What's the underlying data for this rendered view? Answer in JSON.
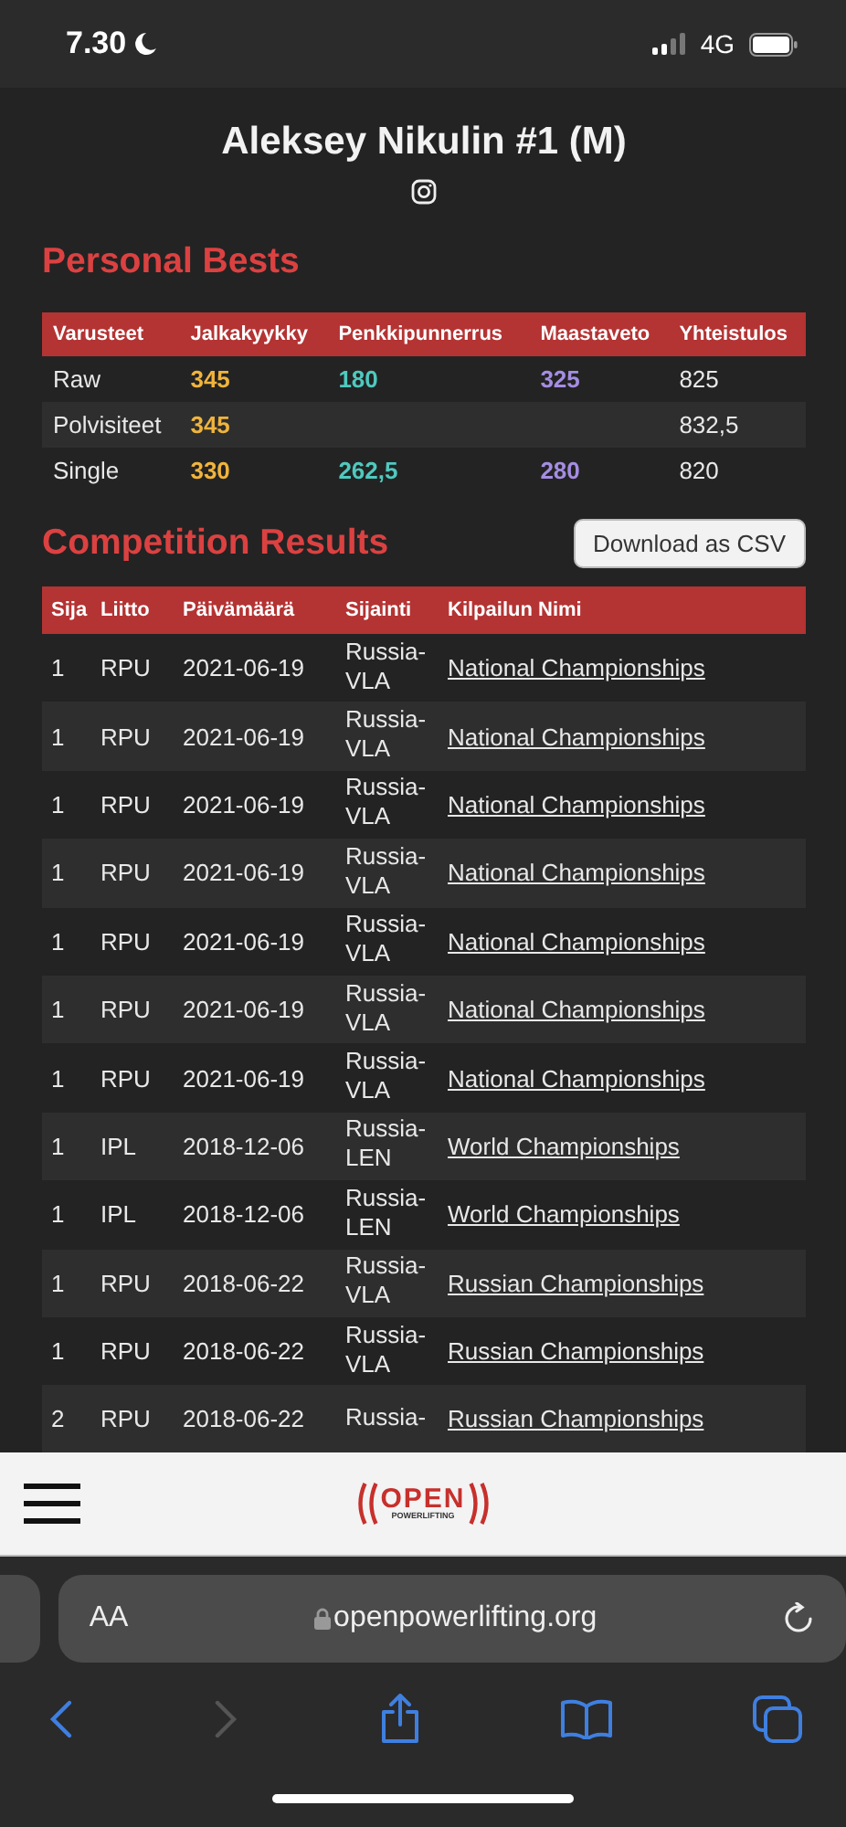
{
  "status_bar": {
    "time": "7.30",
    "network": "4G"
  },
  "athlete": {
    "name": "Aleksey Nikulin #1 (M)"
  },
  "personal_bests": {
    "title": "Personal Bests",
    "columns": [
      {
        "label": "Varusteet"
      },
      {
        "label": "Jalkakyykky",
        "color": "#f0b43c"
      },
      {
        "label": "Penkkipunnerrus",
        "color": "#4fc9bf"
      },
      {
        "label": "Maastaveto",
        "color": "#a58de2"
      },
      {
        "label": "Yhteistulos"
      }
    ],
    "rows": [
      [
        "Raw",
        "345",
        "180",
        "325",
        "825"
      ],
      [
        "Polvisiteet",
        "345",
        "",
        "",
        "832,5"
      ],
      [
        "Single",
        "330",
        "262,5",
        "280",
        "820"
      ]
    ]
  },
  "competition_results": {
    "title": "Competition Results",
    "download_button": "Download as CSV",
    "columns": [
      "Sija",
      "Liitto",
      "Päivämäärä",
      "Sijainti",
      "Kilpailun Nimi"
    ],
    "rows": [
      {
        "place": "1",
        "federation": "RPU",
        "date": "2021-06-19",
        "location": "Russia-VLA",
        "meet": "National Championships"
      },
      {
        "place": "1",
        "federation": "RPU",
        "date": "2021-06-19",
        "location": "Russia-VLA",
        "meet": "National Championships"
      },
      {
        "place": "1",
        "federation": "RPU",
        "date": "2021-06-19",
        "location": "Russia-VLA",
        "meet": "National Championships"
      },
      {
        "place": "1",
        "federation": "RPU",
        "date": "2021-06-19",
        "location": "Russia-VLA",
        "meet": "National Championships"
      },
      {
        "place": "1",
        "federation": "RPU",
        "date": "2021-06-19",
        "location": "Russia-VLA",
        "meet": "National Championships"
      },
      {
        "place": "1",
        "federation": "RPU",
        "date": "2021-06-19",
        "location": "Russia-VLA",
        "meet": "National Championships"
      },
      {
        "place": "1",
        "federation": "RPU",
        "date": "2021-06-19",
        "location": "Russia-VLA",
        "meet": "National Championships"
      },
      {
        "place": "1",
        "federation": "IPL",
        "date": "2018-12-06",
        "location": "Russia-LEN",
        "meet": "World Championships"
      },
      {
        "place": "1",
        "federation": "IPL",
        "date": "2018-12-06",
        "location": "Russia-LEN",
        "meet": "World Championships"
      },
      {
        "place": "1",
        "federation": "RPU",
        "date": "2018-06-22",
        "location": "Russia-VLA",
        "meet": "Russian Championships"
      },
      {
        "place": "1",
        "federation": "RPU",
        "date": "2018-06-22",
        "location": "Russia-VLA",
        "meet": "Russian Championships"
      },
      {
        "place": "2",
        "federation": "RPU",
        "date": "2018-06-22",
        "location": "Russia-",
        "meet": "Russian Championships"
      }
    ]
  },
  "site_nav": {
    "logo_top": "OPEN",
    "logo_bottom": "POWERLIFTING"
  },
  "browser": {
    "text_size": "AA",
    "url": "openpowerlifting.org"
  }
}
